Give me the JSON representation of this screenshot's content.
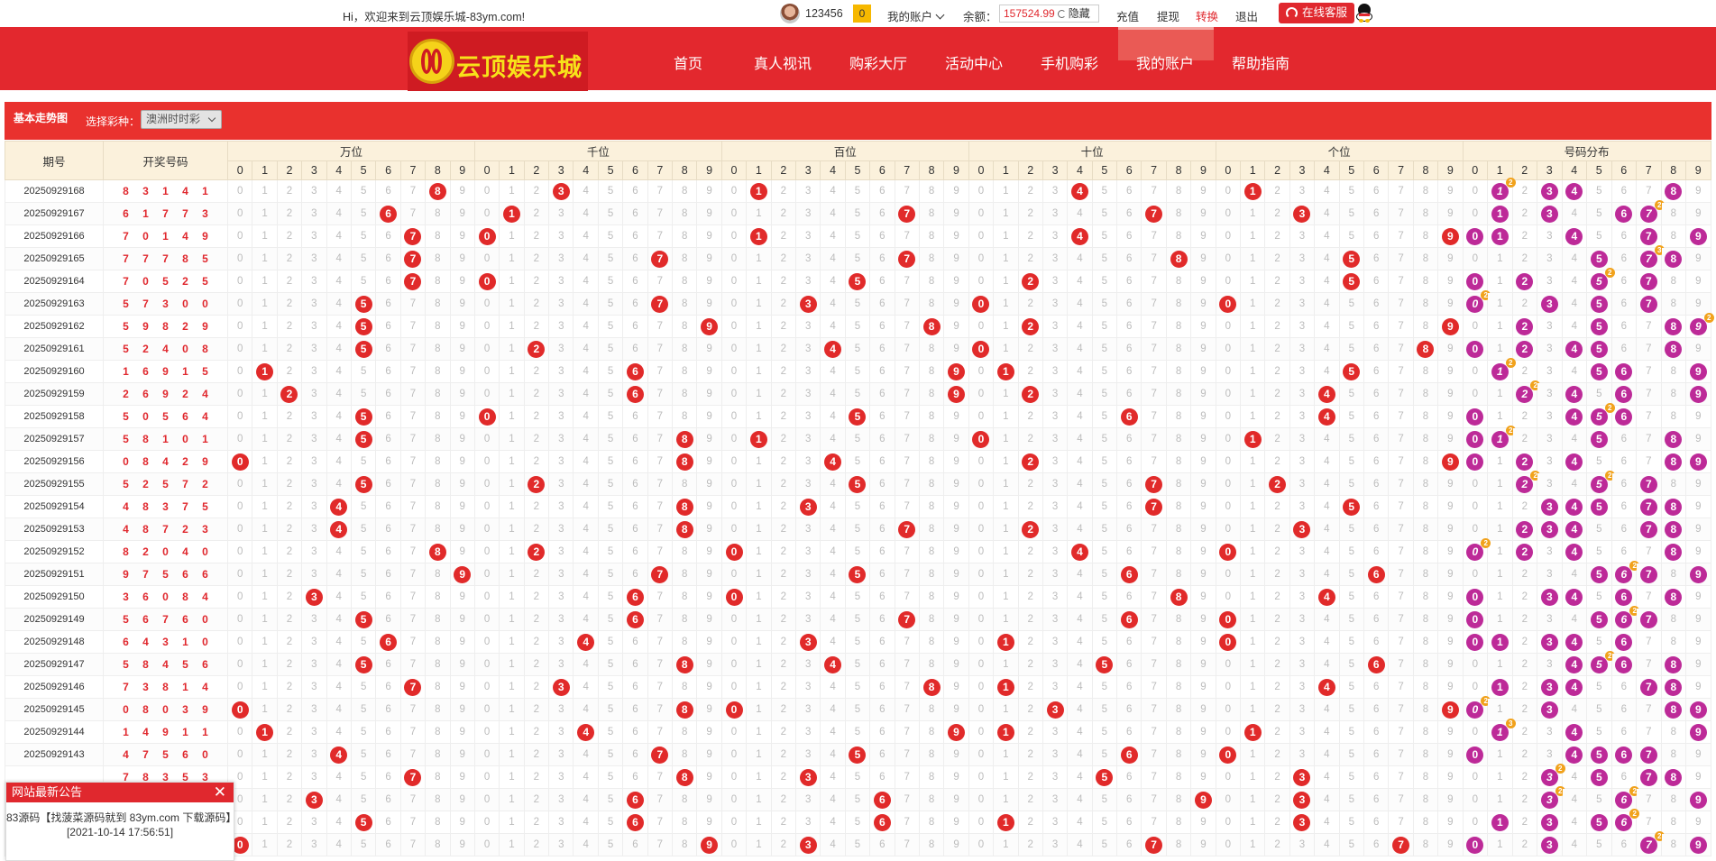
{
  "topbar": {
    "welcome": "Hi，欢迎来到云顶娱乐城-83ym.com!",
    "user_id": "123456",
    "msg_count": "0",
    "my_account": "我的账户",
    "balance_label": "余额：",
    "balance": "157524.99",
    "hide": "隐藏",
    "links": [
      "充值",
      "提现",
      "转换",
      "退出"
    ],
    "service": "在线客服"
  },
  "header": {
    "logo_text": "云顶娱乐城",
    "nav": [
      "首页",
      "真人视讯",
      "购彩大厅",
      "活动中心",
      "手机购彩",
      "我的账户",
      "帮助指南"
    ]
  },
  "panel": {
    "title": "基本走势图",
    "select_label": "选择彩种：",
    "select_value": "澳洲时时彩"
  },
  "table": {
    "col_issue": "期号",
    "col_draw": "开奖号码",
    "groups": [
      "万位",
      "千位",
      "百位",
      "十位",
      "个位",
      "号码分布"
    ],
    "digits": [
      "0",
      "1",
      "2",
      "3",
      "4",
      "5",
      "6",
      "7",
      "8",
      "9"
    ],
    "rows": [
      {
        "issue": "20250929168",
        "nums": [
          8,
          3,
          1,
          4,
          1
        ]
      },
      {
        "issue": "20250929167",
        "nums": [
          6,
          1,
          7,
          7,
          3
        ]
      },
      {
        "issue": "20250929166",
        "nums": [
          7,
          0,
          1,
          4,
          9
        ]
      },
      {
        "issue": "20250929165",
        "nums": [
          7,
          7,
          7,
          8,
          5
        ]
      },
      {
        "issue": "20250929164",
        "nums": [
          7,
          0,
          5,
          2,
          5
        ]
      },
      {
        "issue": "20250929163",
        "nums": [
          5,
          7,
          3,
          0,
          0
        ]
      },
      {
        "issue": "20250929162",
        "nums": [
          5,
          9,
          8,
          2,
          9
        ]
      },
      {
        "issue": "20250929161",
        "nums": [
          5,
          2,
          4,
          0,
          8
        ]
      },
      {
        "issue": "20250929160",
        "nums": [
          1,
          6,
          9,
          1,
          5
        ]
      },
      {
        "issue": "20250929159",
        "nums": [
          2,
          6,
          9,
          2,
          4
        ]
      },
      {
        "issue": "20250929158",
        "nums": [
          5,
          0,
          5,
          6,
          4
        ]
      },
      {
        "issue": "20250929157",
        "nums": [
          5,
          8,
          1,
          0,
          1
        ]
      },
      {
        "issue": "20250929156",
        "nums": [
          0,
          8,
          4,
          2,
          9
        ]
      },
      {
        "issue": "20250929155",
        "nums": [
          5,
          2,
          5,
          7,
          2
        ]
      },
      {
        "issue": "20250929154",
        "nums": [
          4,
          8,
          3,
          7,
          5
        ]
      },
      {
        "issue": "20250929153",
        "nums": [
          4,
          8,
          7,
          2,
          3
        ]
      },
      {
        "issue": "20250929152",
        "nums": [
          8,
          2,
          0,
          4,
          0
        ]
      },
      {
        "issue": "20250929151",
        "nums": [
          9,
          7,
          5,
          6,
          6
        ]
      },
      {
        "issue": "20250929150",
        "nums": [
          3,
          6,
          0,
          8,
          4
        ]
      },
      {
        "issue": "20250929149",
        "nums": [
          5,
          6,
          7,
          6,
          0
        ]
      },
      {
        "issue": "20250929148",
        "nums": [
          6,
          4,
          3,
          1,
          0
        ]
      },
      {
        "issue": "20250929147",
        "nums": [
          5,
          8,
          4,
          5,
          6
        ]
      },
      {
        "issue": "20250929146",
        "nums": [
          7,
          3,
          8,
          1,
          4
        ]
      },
      {
        "issue": "20250929145",
        "nums": [
          0,
          8,
          0,
          3,
          9
        ]
      },
      {
        "issue": "20250929144",
        "nums": [
          1,
          4,
          9,
          1,
          1
        ]
      },
      {
        "issue": "20250929143",
        "nums": [
          4,
          7,
          5,
          6,
          0
        ]
      },
      {
        "issue": "",
        "nums": [
          7,
          8,
          3,
          5,
          3
        ]
      },
      {
        "issue": "",
        "nums": [
          3,
          6,
          6,
          9,
          3
        ]
      },
      {
        "issue": "",
        "nums": [
          5,
          6,
          6,
          1,
          3
        ]
      },
      {
        "issue": "",
        "nums": [
          0,
          9,
          3,
          7,
          7
        ]
      }
    ]
  },
  "notice": {
    "title": "网站最新公告",
    "close": "✕",
    "text": "83源码【找菠菜源码就到 83ym.com 下载源码】",
    "time": "[2021-10-14 17:56:51]"
  }
}
